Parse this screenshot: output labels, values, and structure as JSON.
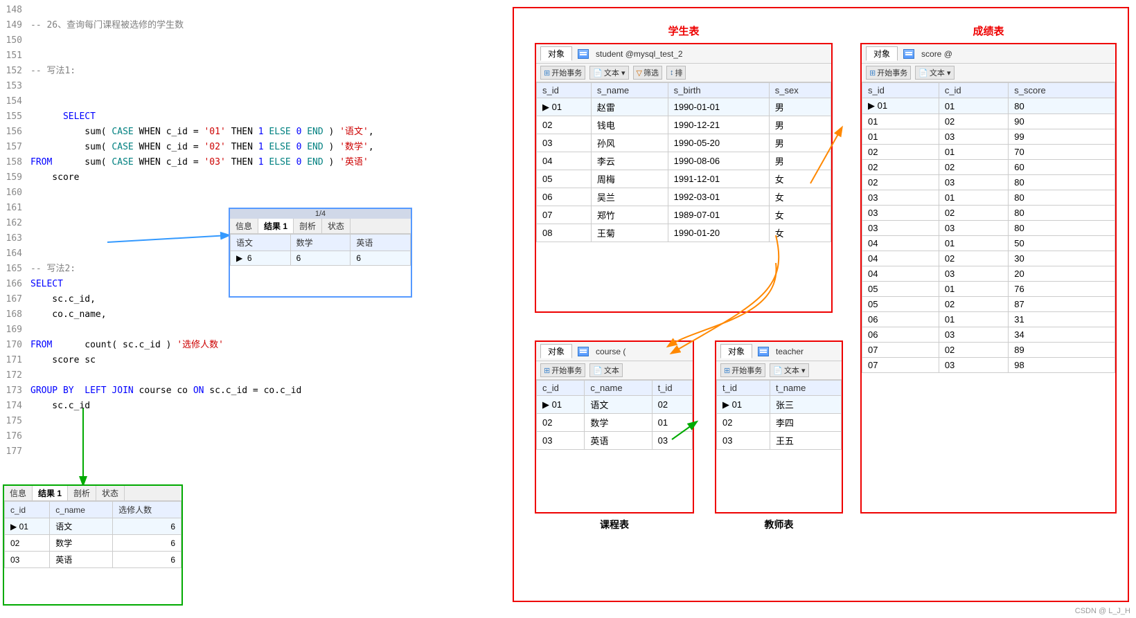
{
  "code": {
    "lines": [
      {
        "num": "148",
        "content": ""
      },
      {
        "num": "149",
        "content": "-- 26、查询每门课程被选修的学生数",
        "type": "comment"
      },
      {
        "num": "150",
        "content": ""
      },
      {
        "num": "151",
        "content": ""
      },
      {
        "num": "152",
        "content": "-- 写法1:",
        "type": "comment"
      },
      {
        "num": "153",
        "content": ""
      },
      {
        "num": "154",
        "content": "SELECT",
        "type": "keyword"
      },
      {
        "num": "155",
        "content": "    sum( CASE WHEN c_id = '01' THEN 1 ELSE 0 END ) '语文',",
        "type": "mixed"
      },
      {
        "num": "156",
        "content": "    sum( CASE WHEN c_id = '02' THEN 1 ELSE 0 END ) '数学',",
        "type": "mixed"
      },
      {
        "num": "157",
        "content": "    sum( CASE WHEN c_id = '03' THEN 1 ELSE 0 END ) '英语'",
        "type": "mixed"
      },
      {
        "num": "158",
        "content": "FROM",
        "type": "keyword"
      },
      {
        "num": "159",
        "content": "    score",
        "type": "default"
      },
      {
        "num": "160",
        "content": ""
      },
      {
        "num": "161",
        "content": ""
      },
      {
        "num": "162",
        "content": ""
      },
      {
        "num": "163",
        "content": ""
      },
      {
        "num": "164",
        "content": ""
      },
      {
        "num": "165",
        "content": "-- 写法2:",
        "type": "comment"
      },
      {
        "num": "166",
        "content": "SELECT",
        "type": "keyword"
      },
      {
        "num": "167",
        "content": "    sc.c_id,",
        "type": "default"
      },
      {
        "num": "168",
        "content": "    co.c_name,",
        "type": "default"
      },
      {
        "num": "169",
        "content": "    count( sc.c_id ) '选修人数'",
        "type": "mixed2"
      },
      {
        "num": "170",
        "content": "FROM",
        "type": "keyword"
      },
      {
        "num": "171",
        "content": "    score sc",
        "type": "default"
      },
      {
        "num": "172",
        "content": "    LEFT JOIN course co ON sc.c_id = co.c_id",
        "type": "join"
      },
      {
        "num": "173",
        "content": "GROUP BY",
        "type": "keyword"
      },
      {
        "num": "174",
        "content": "    sc.c_id",
        "type": "default"
      },
      {
        "num": "175",
        "content": ""
      },
      {
        "num": "176",
        "content": ""
      },
      {
        "num": "177",
        "content": ""
      }
    ]
  },
  "result_popup": {
    "tabs": [
      "信息",
      "结果 1",
      "剖析",
      "状态"
    ],
    "active_tab": "结果 1",
    "pagination": "1/4",
    "headers": [
      "语文",
      "数学",
      "英语"
    ],
    "rows": [
      {
        "arrow": "▶",
        "col1": "6",
        "col2": "6",
        "col3": "6"
      }
    ]
  },
  "bottom_result": {
    "tabs": [
      "信息",
      "结果 1",
      "剖析",
      "状态"
    ],
    "active_tab": "结果 1",
    "headers": [
      "c_id",
      "c_name",
      "选修人数"
    ],
    "rows": [
      {
        "arrow": "▶",
        "col1": "01",
        "col2": "语文",
        "col3": "6"
      },
      {
        "arrow": "",
        "col1": "02",
        "col2": "数学",
        "col3": "6"
      },
      {
        "arrow": "",
        "col1": "03",
        "col2": "英语",
        "col3": "6"
      }
    ]
  },
  "student_table": {
    "title": "学生表",
    "tab_label": "对象",
    "db_label": "student @mysql_test_2",
    "toolbar": [
      "开始事务",
      "文本·",
      "筛选",
      "排序"
    ],
    "headers": [
      "s_id",
      "s_name",
      "s_birth",
      "s_sex"
    ],
    "rows": [
      {
        "arrow": "▶",
        "s_id": "01",
        "s_name": "赵雷",
        "s_birth": "1990-01-01",
        "s_sex": "男"
      },
      {
        "arrow": "",
        "s_id": "02",
        "s_name": "钱电",
        "s_birth": "1990-12-21",
        "s_sex": "男"
      },
      {
        "arrow": "",
        "s_id": "03",
        "s_name": "孙风",
        "s_birth": "1990-05-20",
        "s_sex": "男"
      },
      {
        "arrow": "",
        "s_id": "04",
        "s_name": "李云",
        "s_birth": "1990-08-06",
        "s_sex": "男"
      },
      {
        "arrow": "",
        "s_id": "05",
        "s_name": "周梅",
        "s_birth": "1991-12-01",
        "s_sex": "女"
      },
      {
        "arrow": "",
        "s_id": "06",
        "s_name": "吴兰",
        "s_birth": "1992-03-01",
        "s_sex": "女"
      },
      {
        "arrow": "",
        "s_id": "07",
        "s_name": "郑竹",
        "s_birth": "1989-07-01",
        "s_sex": "女"
      },
      {
        "arrow": "",
        "s_id": "08",
        "s_name": "王菊",
        "s_birth": "1990-01-20",
        "s_sex": "女"
      }
    ]
  },
  "score_table": {
    "title": "成绩表",
    "tab_label": "对象",
    "db_label": "score @",
    "toolbar": [
      "开始事务",
      "文本·"
    ],
    "headers": [
      "s_id",
      "c_id",
      "s_score"
    ],
    "rows": [
      {
        "arrow": "▶",
        "s_id": "01",
        "c_id": "01",
        "s_score": "80"
      },
      {
        "arrow": "",
        "s_id": "01",
        "c_id": "02",
        "s_score": "90"
      },
      {
        "arrow": "",
        "s_id": "01",
        "c_id": "03",
        "s_score": "99"
      },
      {
        "arrow": "",
        "s_id": "02",
        "c_id": "01",
        "s_score": "70"
      },
      {
        "arrow": "",
        "s_id": "02",
        "c_id": "02",
        "s_score": "60"
      },
      {
        "arrow": "",
        "s_id": "02",
        "c_id": "03",
        "s_score": "80"
      },
      {
        "arrow": "",
        "s_id": "03",
        "c_id": "01",
        "s_score": "80"
      },
      {
        "arrow": "",
        "s_id": "03",
        "c_id": "02",
        "s_score": "80"
      },
      {
        "arrow": "",
        "s_id": "03",
        "c_id": "03",
        "s_score": "80"
      },
      {
        "arrow": "",
        "s_id": "04",
        "c_id": "01",
        "s_score": "50"
      },
      {
        "arrow": "",
        "s_id": "04",
        "c_id": "02",
        "s_score": "30"
      },
      {
        "arrow": "",
        "s_id": "04",
        "c_id": "03",
        "s_score": "20"
      },
      {
        "arrow": "",
        "s_id": "05",
        "c_id": "01",
        "s_score": "76"
      },
      {
        "arrow": "",
        "s_id": "05",
        "c_id": "02",
        "s_score": "87"
      },
      {
        "arrow": "",
        "s_id": "06",
        "c_id": "01",
        "s_score": "31"
      },
      {
        "arrow": "",
        "s_id": "06",
        "c_id": "03",
        "s_score": "34"
      },
      {
        "arrow": "",
        "s_id": "07",
        "c_id": "02",
        "s_score": "89"
      },
      {
        "arrow": "",
        "s_id": "07",
        "c_id": "03",
        "s_score": "98"
      }
    ]
  },
  "course_table": {
    "title": "课程表",
    "tab_label": "对象",
    "db_label": "course (",
    "toolbar": [
      "开始事务",
      "文本"
    ],
    "headers": [
      "c_id",
      "c_name",
      "t_id"
    ],
    "rows": [
      {
        "arrow": "▶",
        "c_id": "01",
        "c_name": "语文",
        "t_id": "02"
      },
      {
        "arrow": "",
        "c_id": "02",
        "c_name": "数学",
        "t_id": "01"
      },
      {
        "arrow": "",
        "c_id": "03",
        "c_name": "英语",
        "t_id": "03"
      }
    ]
  },
  "teacher_table": {
    "title": "教师表",
    "tab_label": "对象",
    "db_label": "teacher",
    "toolbar": [
      "开始事务",
      "文本·"
    ],
    "headers": [
      "t_id",
      "t_name"
    ],
    "rows": [
      {
        "arrow": "▶",
        "t_id": "01",
        "t_name": "张三"
      },
      {
        "arrow": "",
        "t_id": "02",
        "t_name": "李四"
      },
      {
        "arrow": "",
        "t_id": "03",
        "t_name": "王五"
      }
    ]
  },
  "labels": {
    "student_title": "学生表",
    "score_title": "成绩表",
    "course_title": "课程表",
    "teacher_title": "教师表",
    "watermark": "CSDN @ L_J_H"
  }
}
